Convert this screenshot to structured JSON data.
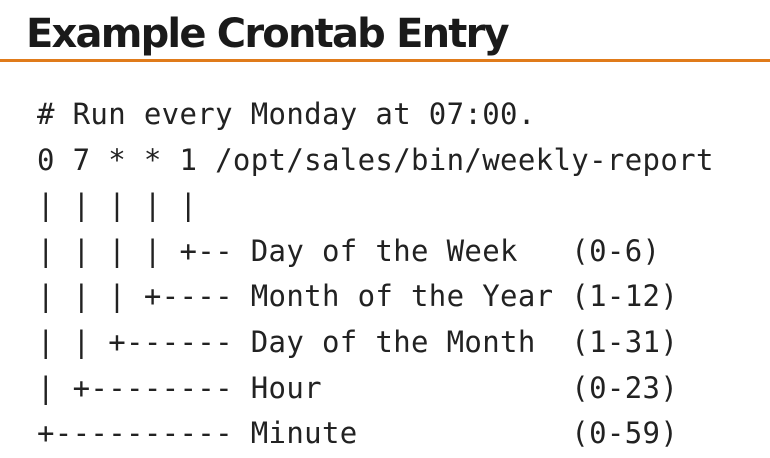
{
  "slide": {
    "title": "Example Crontab Entry"
  },
  "code": {
    "lines": [
      "# Run every Monday at 07:00.",
      "0 7 * * 1 /opt/sales/bin/weekly-report",
      "| | | | |",
      "| | | | +-- Day of the Week   (0-6)",
      "| | | +---- Month of the Year (1-12)",
      "| | +------ Day of the Month  (1-31)",
      "| +-------- Hour              (0-23)",
      "+---------- Minute            (0-59)"
    ]
  },
  "colors": {
    "accent_rule": "#e07b1a",
    "text": "#222222"
  }
}
